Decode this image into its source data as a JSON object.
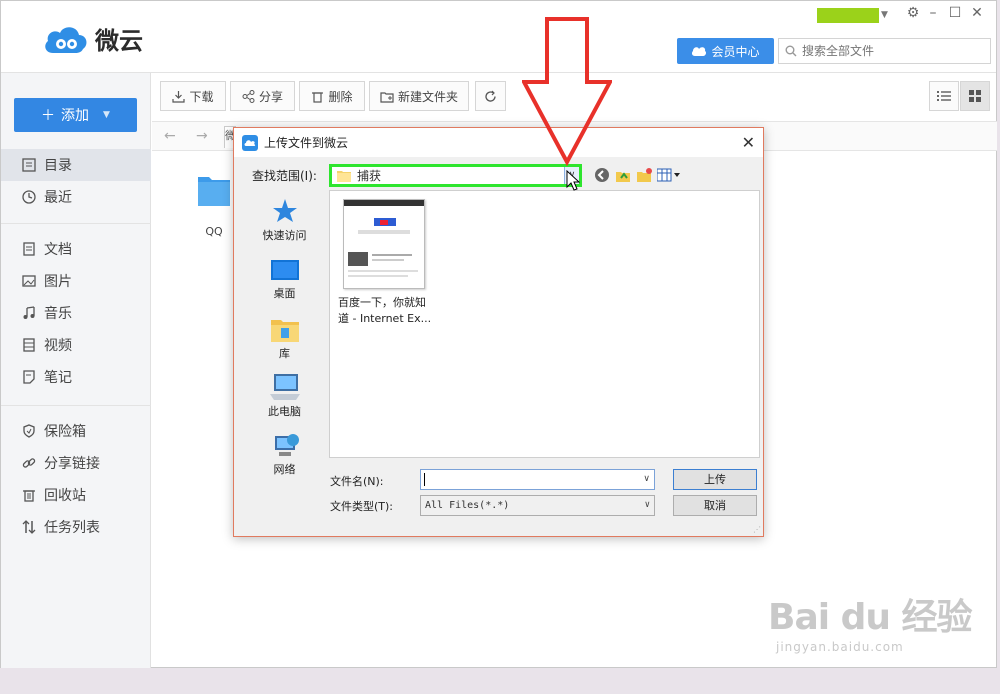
{
  "app": {
    "name": "微云",
    "vip_label": "会员中心",
    "search_placeholder": "搜索全部文件",
    "add_label": "添加",
    "toolbar": {
      "download": "下载",
      "share": "分享",
      "delete": "删除",
      "new_folder": "新建文件夹"
    },
    "crumb_tab": "微",
    "sidebar": {
      "items": [
        {
          "label": "目录",
          "icon": "directory-icon"
        },
        {
          "label": "最近",
          "icon": "clock-icon"
        },
        {
          "label": "文档",
          "icon": "document-icon"
        },
        {
          "label": "图片",
          "icon": "image-icon"
        },
        {
          "label": "音乐",
          "icon": "music-icon"
        },
        {
          "label": "视频",
          "icon": "video-icon"
        },
        {
          "label": "笔记",
          "icon": "note-icon"
        },
        {
          "label": "保险箱",
          "icon": "shield-icon"
        },
        {
          "label": "分享链接",
          "icon": "link-icon"
        },
        {
          "label": "回收站",
          "icon": "trash-icon"
        },
        {
          "label": "任务列表",
          "icon": "transfer-icon"
        }
      ]
    },
    "folder": {
      "name": "QQ"
    }
  },
  "dialog": {
    "title": "上传文件到微云",
    "lookin_label": "查找范围(I):",
    "lookin_value": "捕获",
    "places": [
      "快速访问",
      "桌面",
      "库",
      "此电脑",
      "网络"
    ],
    "file": {
      "line1": "百度一下，你就知",
      "line2": "道 - Internet Ex..."
    },
    "filename_label": "文件名(N):",
    "filename_value": "",
    "filetype_label": "文件类型(T):",
    "filetype_value": "All Files(*.*)",
    "upload_label": "上传",
    "cancel_label": "取消"
  },
  "colors": {
    "accent": "#3387e3",
    "highlight": "#2ee52e",
    "annotation_arrow": "#e8312a"
  },
  "watermark": {
    "big": "Bai du 经验",
    "small": "jingyan.baidu.com"
  }
}
